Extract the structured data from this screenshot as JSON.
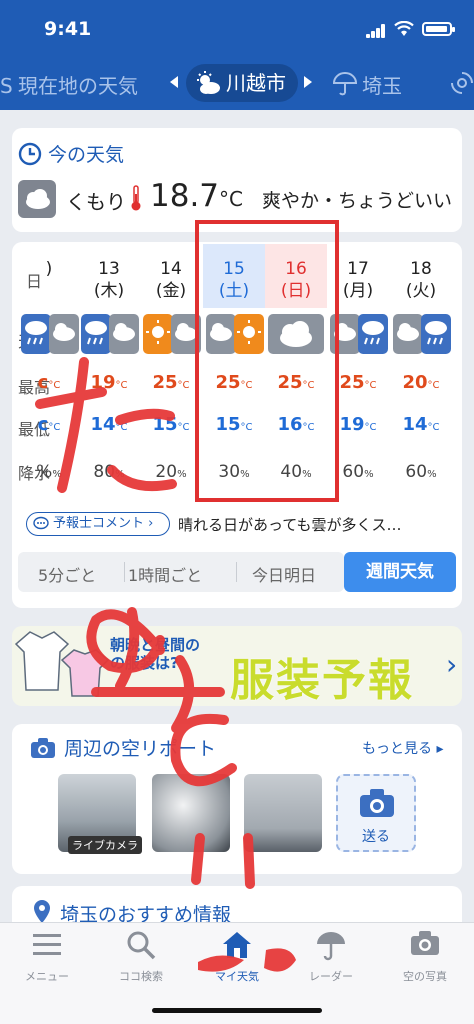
{
  "status": {
    "time": "9:41"
  },
  "locations": {
    "left": "現在地の天気",
    "current": "川越市",
    "right": "埼玉"
  },
  "now": {
    "title": "今の天気",
    "condition": "くもり",
    "temp": "18.7",
    "unit": "°C",
    "description": "爽やか・ちょうどいい"
  },
  "week": {
    "row_labels": [
      "日",
      "天気",
      "最高",
      "最低",
      "降水"
    ],
    "days": [
      {
        "date": "",
        "dow": ")",
        "icon": "rain",
        "hi": "c",
        "lo": "c",
        "prec": "%"
      },
      {
        "date": "13",
        "dow": "(木)",
        "icon": "rain",
        "hi": "19",
        "lo": "14",
        "prec": "80"
      },
      {
        "date": "14",
        "dow": "(金)",
        "icon": "sun-cloud",
        "hi": "25",
        "lo": "15",
        "prec": "20"
      },
      {
        "date": "15",
        "dow": "(土)",
        "icon": "cloud-sun",
        "hi": "25",
        "lo": "15",
        "prec": "30"
      },
      {
        "date": "16",
        "dow": "(日)",
        "icon": "cloud",
        "hi": "25",
        "lo": "16",
        "prec": "40"
      },
      {
        "date": "17",
        "dow": "(月)",
        "icon": "cloud-rain",
        "hi": "25",
        "lo": "19",
        "prec": "60"
      },
      {
        "date": "18",
        "dow": "(火)",
        "icon": "cloud-rain",
        "hi": "20",
        "lo": "14",
        "prec": "60"
      }
    ],
    "unit_c": "°C",
    "unit_pct": "%",
    "comment_button": "予報士コメント",
    "comment_text": "晴れる日があっても雲が多くス…",
    "segments": [
      "5分ごと",
      "1時間ごと",
      "今日明日"
    ],
    "weekly_button": "週間天気"
  },
  "ad": {
    "line1": "朝晩と昼間の",
    "line2": "の服装は?",
    "main": "服装予報"
  },
  "sky": {
    "title": "周辺の空リポート",
    "more": "もっと見る",
    "photo_tag": "ライブカメラ",
    "send": "送る"
  },
  "recommend": {
    "title": "埼玉のおすすめ情報"
  },
  "tabs": [
    {
      "label": "メニュー"
    },
    {
      "label": "ココ検索"
    },
    {
      "label": "マイ天気"
    },
    {
      "label": "レーダー"
    },
    {
      "label": "空の写真"
    }
  ],
  "colors": {
    "brand": "#1f5cb5",
    "high": "#e04a1c",
    "low": "#1f6bd6",
    "annotation": "#e03030"
  }
}
